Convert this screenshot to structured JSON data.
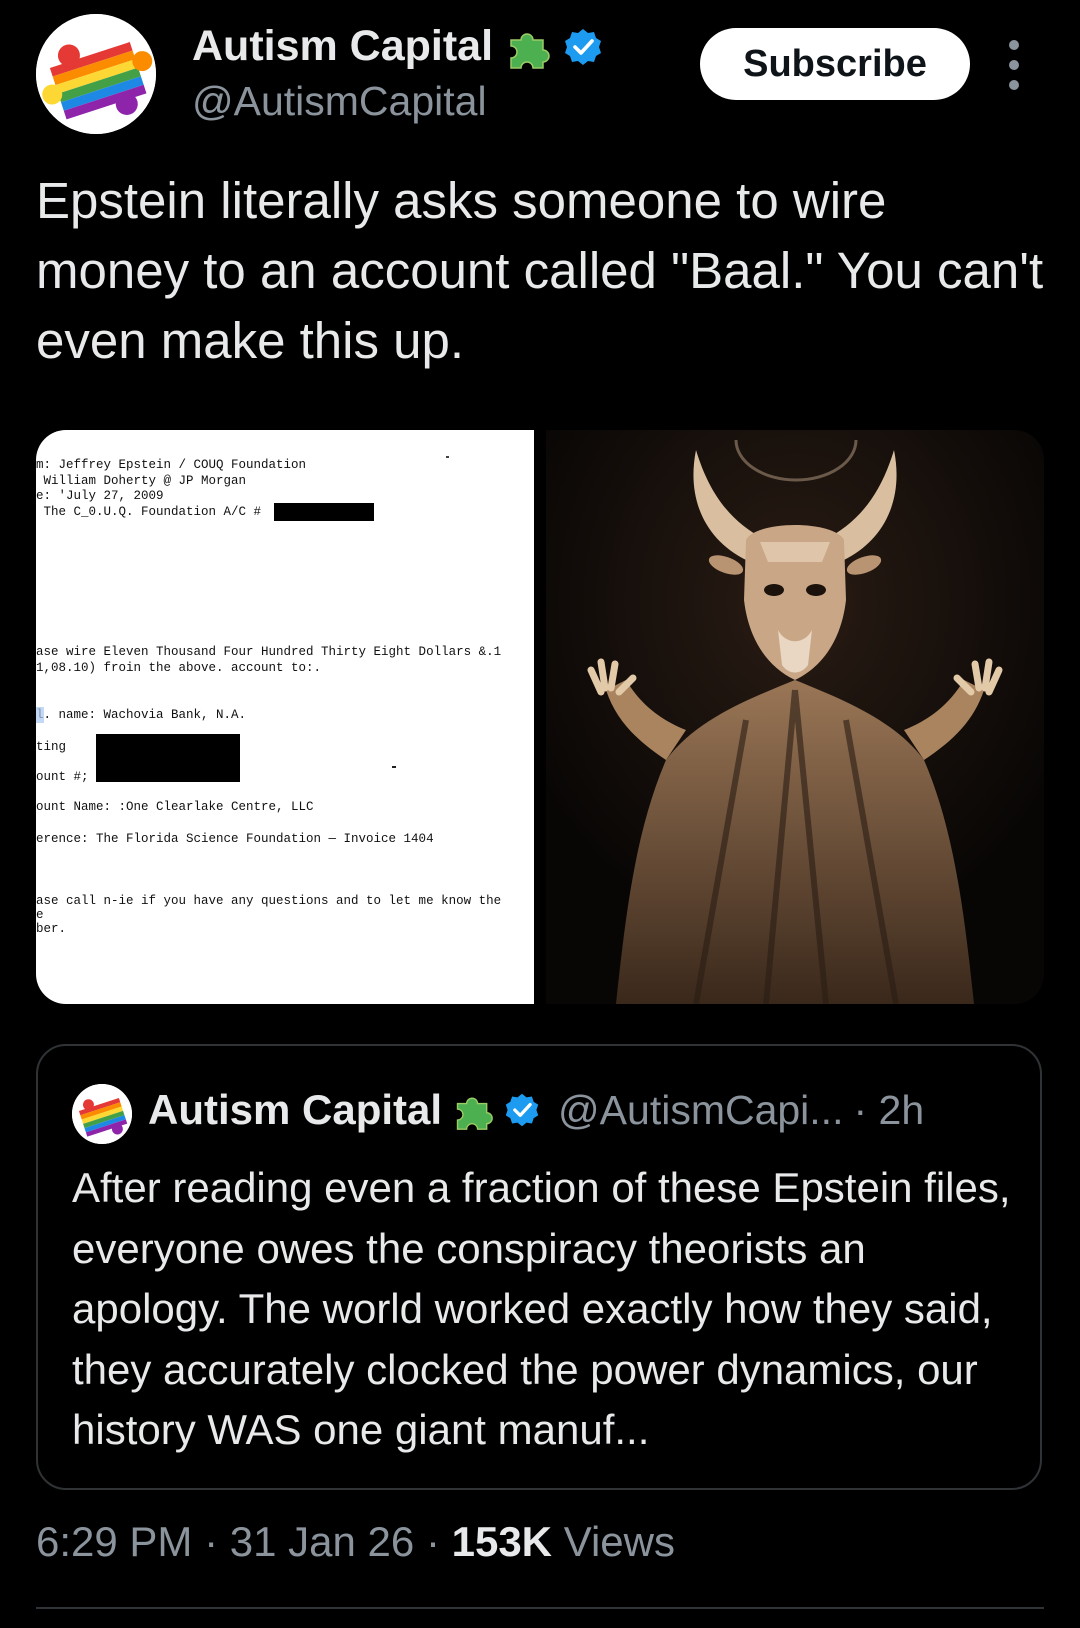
{
  "author": {
    "name": "Autism Capital",
    "handle": "@AutismCapital",
    "puzzle_icon": "green-puzzle-icon",
    "verified_icon": "verified-badge-icon"
  },
  "actions": {
    "subscribe_label": "Subscribe",
    "more_icon": "more-vertical-icon"
  },
  "tweet": {
    "text": "Epstein literally asks someone to wire money to an account called \"Baal.\" You can't even make this up."
  },
  "media": {
    "document_lines": [
      "m: Jeffrey Epstein / COUQ Foundation",
      " William Doherty @ JP Morgan",
      "e: 'July 27, 2009",
      " The C_0.U.Q. Foundation A/C #",
      "ase wire Eleven Thousand Four Hundred Thirty Eight Dollars &.1",
      "1,08.10) froin the above. account to:.",
      "l. name: Wachovia Bank, N.A.",
      "ting",
      "ount #;",
      "ount Name: :One Clearlake Centre, LLC",
      "erence: The Florida Science Foundation — Invoice 1404",
      "ase call n-ie if you have any questions and to let me know the",
      "e",
      "ber."
    ]
  },
  "quote": {
    "name": "Autism Capital",
    "handle": "@AutismCapi...",
    "time": "· 2h",
    "text": "After reading even a fraction of these Epstein files, everyone owes the conspiracy theorists an apology. The world worked exactly how they said, they accurately clocked the power dynamics, our history WAS one giant manuf..."
  },
  "meta": {
    "time": "6:29 PM",
    "date": "31 Jan 26",
    "views_count": "153K",
    "views_label": "Views",
    "sep": "·"
  },
  "colors": {
    "background": "#000000",
    "text": "#e7e9ea",
    "muted": "#8b949c",
    "verified": "#1d9bf0",
    "puzzle": "#4caf50",
    "border": "#2f3336"
  }
}
